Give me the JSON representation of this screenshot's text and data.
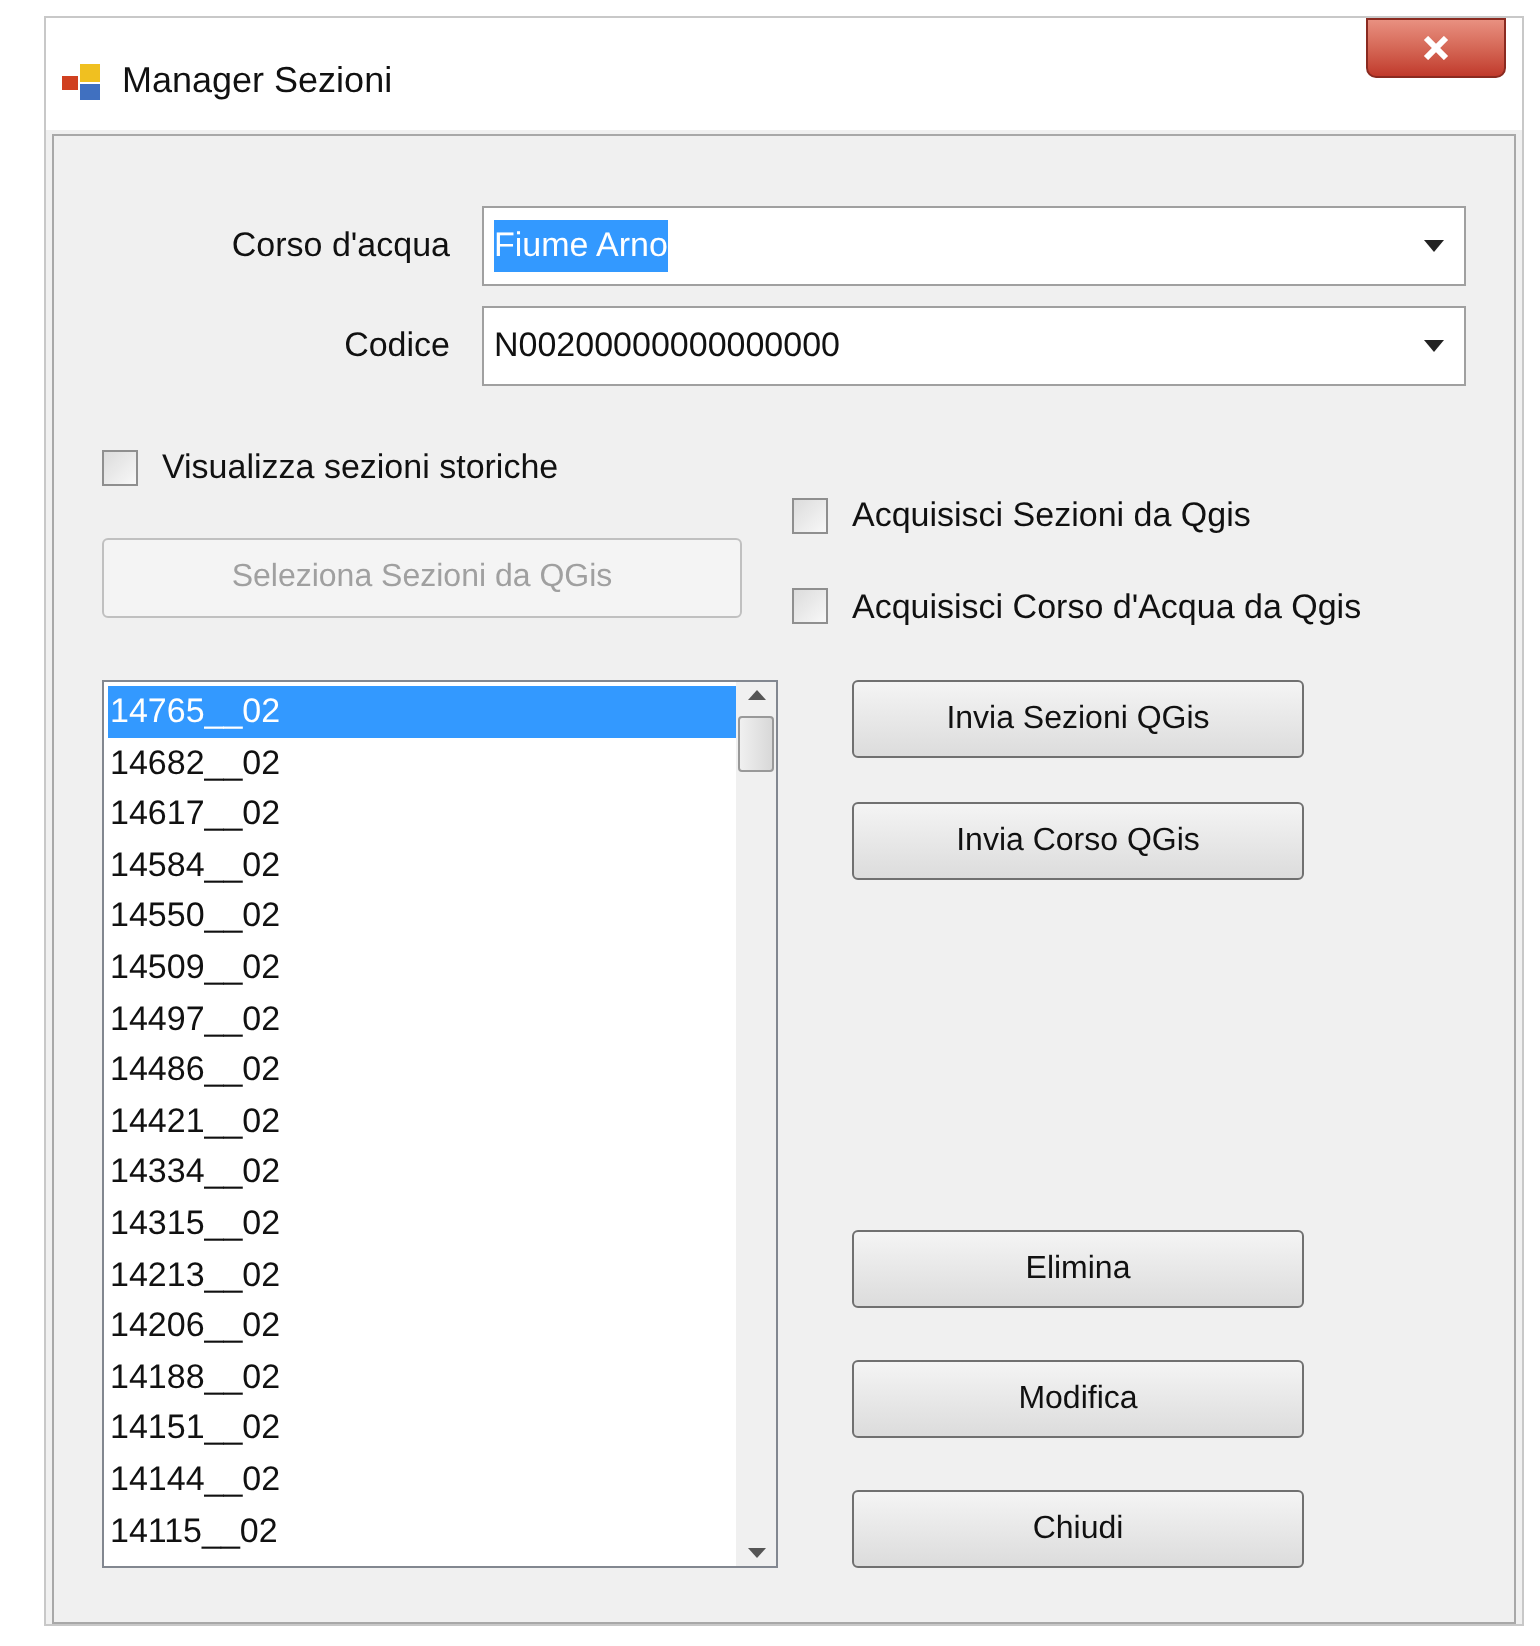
{
  "window": {
    "title": "Manager Sezioni"
  },
  "fields": [
    {
      "label": "Corso d'acqua",
      "value": "Fiume Arno",
      "highlighted": true
    },
    {
      "label": "Codice",
      "value": "N00200000000000000",
      "highlighted": false
    }
  ],
  "storiche": {
    "label": "Visualizza sezioni storiche",
    "checked": false
  },
  "seleziona_button": {
    "label": "Seleziona Sezioni da QGis",
    "disabled": true
  },
  "options": [
    {
      "label": "Acquisisci Sezioni da Qgis",
      "checked": false
    },
    {
      "label": "Acquisisci Corso d'Acqua da Qgis",
      "checked": false
    }
  ],
  "sections": [
    {
      "label": "14765__02",
      "selected": true
    },
    {
      "label": "14682__02",
      "selected": false
    },
    {
      "label": "14617__02",
      "selected": false
    },
    {
      "label": "14584__02",
      "selected": false
    },
    {
      "label": "14550__02",
      "selected": false
    },
    {
      "label": "14509__02",
      "selected": false
    },
    {
      "label": "14497__02",
      "selected": false
    },
    {
      "label": "14486__02",
      "selected": false
    },
    {
      "label": "14421__02",
      "selected": false
    },
    {
      "label": "14334__02",
      "selected": false
    },
    {
      "label": "14315__02",
      "selected": false
    },
    {
      "label": "14213__02",
      "selected": false
    },
    {
      "label": "14206__02",
      "selected": false
    },
    {
      "label": "14188__02",
      "selected": false
    },
    {
      "label": "14151__02",
      "selected": false
    },
    {
      "label": "14144__02",
      "selected": false
    },
    {
      "label": "14115__02",
      "selected": false
    }
  ],
  "top_buttons": [
    "Invia Sezioni QGis",
    "Invia Corso QGis"
  ],
  "bottom_buttons": [
    "Elimina",
    "Modifica",
    "Chiudi"
  ]
}
